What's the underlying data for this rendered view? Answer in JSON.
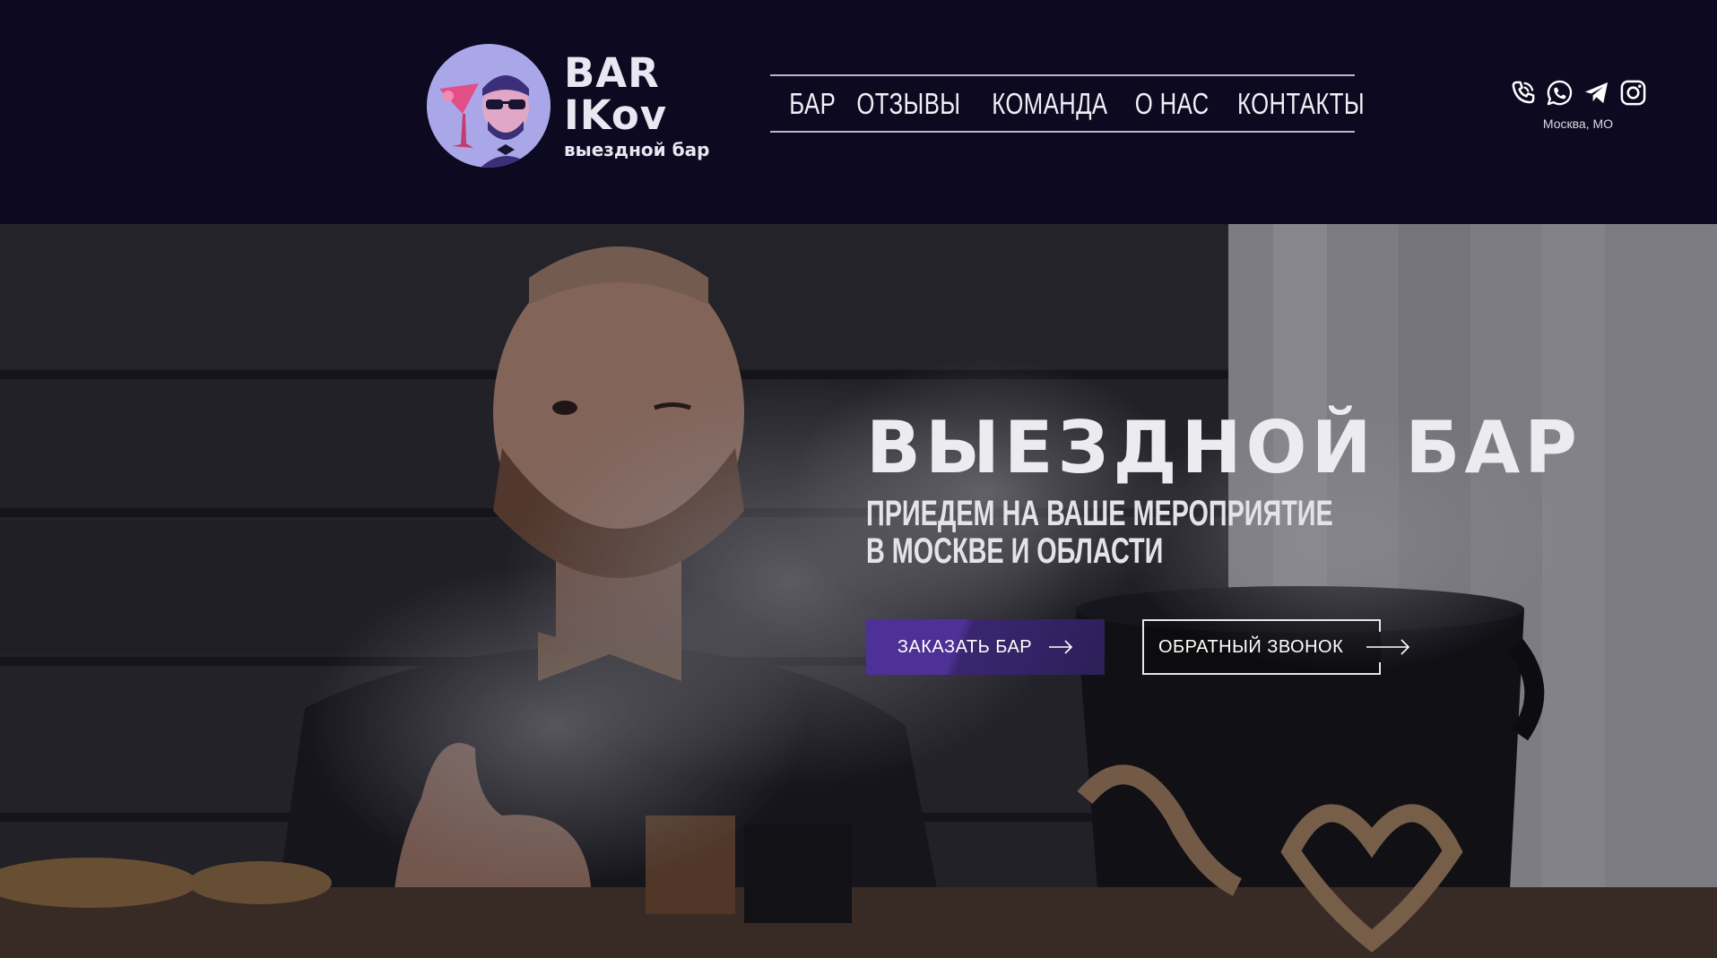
{
  "header": {
    "logo": {
      "line1": "BAR",
      "line2": "IKov",
      "line3": "выездной бар"
    },
    "nav": [
      {
        "label": "БАР"
      },
      {
        "label": "ОТЗЫВЫ"
      },
      {
        "label": "КОМАНДА"
      },
      {
        "label": "О НАС"
      },
      {
        "label": "КОНТАКТЫ"
      }
    ],
    "social": {
      "icons": [
        "phone-icon",
        "whatsapp-icon",
        "telegram-icon",
        "instagram-icon"
      ],
      "city": "Москва, МО"
    }
  },
  "hero": {
    "title": "ВЫЕЗДНОЙ БАР",
    "subtitle_line1": "ПРИЕДЕМ НА ВАШЕ МЕРОПРИЯТИЕ",
    "subtitle_line2": "В МОСКВЕ И ОБЛАСТИ",
    "order_button": "ЗАКАЗАТЬ БАР",
    "call_button": "ОБРАТНЫЙ ЗВОНОК"
  },
  "colors": {
    "header_bg": "#0d0920",
    "accent": "#4d3197",
    "logo_circle": "#a9a6e6"
  }
}
